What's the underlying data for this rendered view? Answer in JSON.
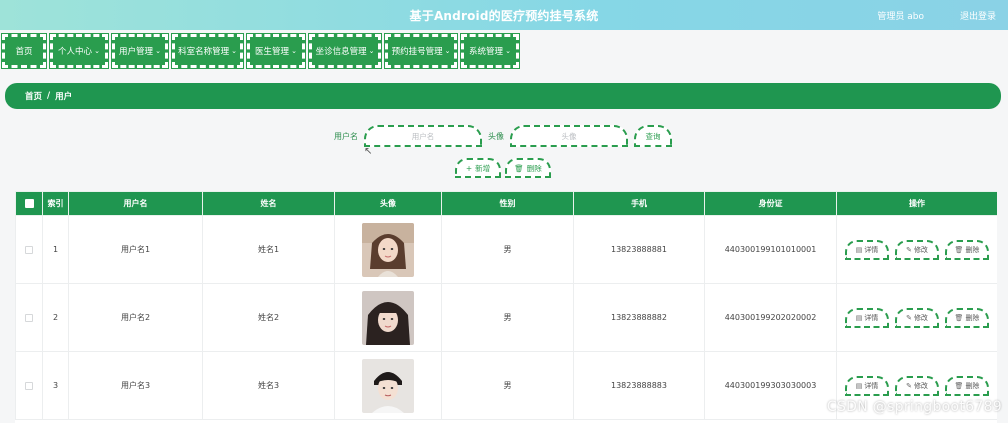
{
  "header": {
    "title": "基于Android的医疗预约挂号系统",
    "user": "管理员 abo",
    "logout": "退出登录"
  },
  "nav": [
    {
      "label": "首页",
      "has_dropdown": false
    },
    {
      "label": "个人中心",
      "has_dropdown": true
    },
    {
      "label": "用户管理",
      "has_dropdown": true
    },
    {
      "label": "科室名称管理",
      "has_dropdown": true
    },
    {
      "label": "医生管理",
      "has_dropdown": true
    },
    {
      "label": "坐诊信息管理",
      "has_dropdown": true
    },
    {
      "label": "预约挂号管理",
      "has_dropdown": true
    },
    {
      "label": "系统管理",
      "has_dropdown": true
    }
  ],
  "breadcrumb": {
    "home": "首页",
    "separator": "/",
    "current": "用户"
  },
  "search": {
    "username_label": "用户名",
    "username_placeholder": "用户名",
    "avatar_label": "头像",
    "avatar_placeholder": "头像",
    "query_button": "查询",
    "add_button": "新增",
    "delete_button": "删除"
  },
  "table": {
    "headers": [
      "",
      "索引",
      "用户名",
      "姓名",
      "头像",
      "性别",
      "手机",
      "身份证",
      "操作"
    ],
    "rows": [
      {
        "index": "1",
        "username": "用户名1",
        "name": "姓名1",
        "gender": "男",
        "phone": "13823888881",
        "id_card": "440300199101010001",
        "avatar": "avatar-photo-1"
      },
      {
        "index": "2",
        "username": "用户名2",
        "name": "姓名2",
        "gender": "男",
        "phone": "13823888882",
        "id_card": "440300199202020002",
        "avatar": "avatar-photo-2"
      },
      {
        "index": "3",
        "username": "用户名3",
        "name": "姓名3",
        "gender": "男",
        "phone": "13823888883",
        "id_card": "440300199303030003",
        "avatar": "avatar-photo-3"
      }
    ],
    "row_actions": {
      "detail": "详情",
      "edit": "修改",
      "delete": "删除"
    }
  },
  "watermark": "CSDN @springboot6789",
  "colors": {
    "primary_green": "#1f9650",
    "topbar_start": "#9ee3d9",
    "topbar_end": "#8ad2e6"
  }
}
